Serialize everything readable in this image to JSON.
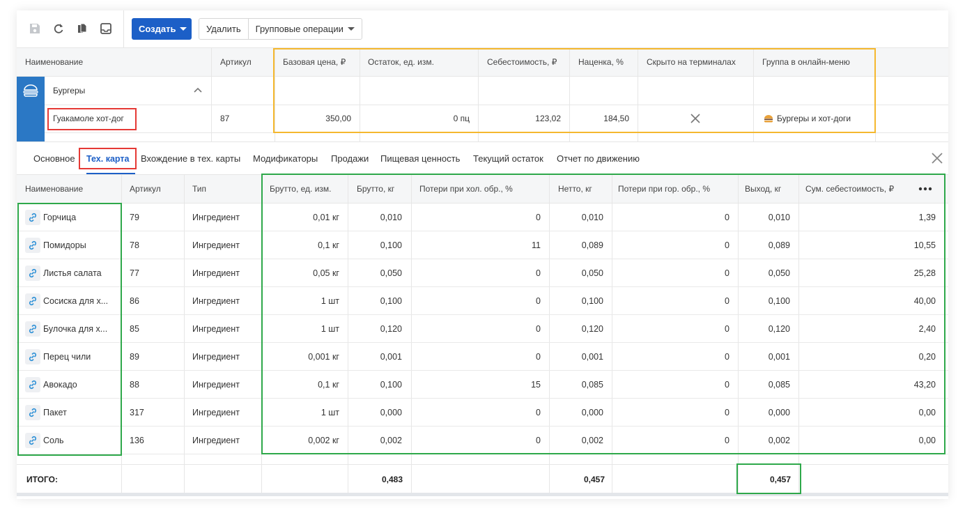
{
  "toolbar": {
    "icons": [
      "save-icon",
      "refresh-icon",
      "copy-icon",
      "inbox-icon"
    ],
    "create_label": "Создать",
    "delete_label": "Удалить",
    "group_ops_label": "Групповые операции"
  },
  "products": {
    "headers": [
      "Наименование",
      "Артикул",
      "Базовая цена, ₽",
      "Остаток, ед. изм.",
      "Себестоимость, ₽",
      "Наценка, %",
      "Скрыто на терминалах",
      "Группа в онлайн-меню"
    ],
    "group_row": {
      "name": "Бургеры"
    },
    "item": {
      "name": "Гуакамоле хот-дог",
      "article": "87",
      "base_price": "350,00",
      "stock": "0 пц",
      "cost": "123,02",
      "markup": "184,50",
      "group": "Бургеры и хот-доги"
    }
  },
  "tabs": [
    {
      "label": "Основное"
    },
    {
      "label": "Тех. карта"
    },
    {
      "label": "Вхождение в тех. карты"
    },
    {
      "label": "Модификаторы"
    },
    {
      "label": "Продажи"
    },
    {
      "label": "Пищевая ценность"
    },
    {
      "label": "Текущий остаток"
    },
    {
      "label": "Отчет по движению"
    }
  ],
  "ingredients": {
    "headers": [
      "Наименование",
      "Артикул",
      "Тип",
      "Брутто, ед. изм.",
      "Брутто, кг",
      "Потери при хол. обр., %",
      "Нетто, кг",
      "Потери при гор. обр., %",
      "Выход, кг",
      "Сум. себестоимость, ₽"
    ],
    "rows": [
      {
        "name": "Горчица",
        "article": "79",
        "type": "Ингредиент",
        "gross_unit": "0,01 кг",
        "gross_kg": "0,010",
        "cold_loss": "0",
        "net_kg": "0,010",
        "hot_loss": "0",
        "yield_kg": "0,010",
        "cost": "1,39"
      },
      {
        "name": "Помидоры",
        "article": "78",
        "type": "Ингредиент",
        "gross_unit": "0,1 кг",
        "gross_kg": "0,100",
        "cold_loss": "11",
        "net_kg": "0,089",
        "hot_loss": "0",
        "yield_kg": "0,089",
        "cost": "10,55"
      },
      {
        "name": "Листья салата",
        "article": "77",
        "type": "Ингредиент",
        "gross_unit": "0,05 кг",
        "gross_kg": "0,050",
        "cold_loss": "0",
        "net_kg": "0,050",
        "hot_loss": "0",
        "yield_kg": "0,050",
        "cost": "25,28"
      },
      {
        "name": "Сосиска для х...",
        "article": "86",
        "type": "Ингредиент",
        "gross_unit": "1 шт",
        "gross_kg": "0,100",
        "cold_loss": "0",
        "net_kg": "0,100",
        "hot_loss": "0",
        "yield_kg": "0,100",
        "cost": "40,00"
      },
      {
        "name": "Булочка для х...",
        "article": "85",
        "type": "Ингредиент",
        "gross_unit": "1 шт",
        "gross_kg": "0,120",
        "cold_loss": "0",
        "net_kg": "0,120",
        "hot_loss": "0",
        "yield_kg": "0,120",
        "cost": "2,40"
      },
      {
        "name": "Перец чили",
        "article": "89",
        "type": "Ингредиент",
        "gross_unit": "0,001 кг",
        "gross_kg": "0,001",
        "cold_loss": "0",
        "net_kg": "0,001",
        "hot_loss": "0",
        "yield_kg": "0,001",
        "cost": "0,20"
      },
      {
        "name": "Авокадо",
        "article": "88",
        "type": "Ингредиент",
        "gross_unit": "0,1 кг",
        "gross_kg": "0,100",
        "cold_loss": "15",
        "net_kg": "0,085",
        "hot_loss": "0",
        "yield_kg": "0,085",
        "cost": "43,20"
      },
      {
        "name": "Пакет",
        "article": "317",
        "type": "Ингредиент",
        "gross_unit": "1 шт",
        "gross_kg": "0,000",
        "cold_loss": "0",
        "net_kg": "0,000",
        "hot_loss": "0",
        "yield_kg": "0,000",
        "cost": "0,00"
      },
      {
        "name": "Соль",
        "article": "136",
        "type": "Ингредиент",
        "gross_unit": "0,002 кг",
        "gross_kg": "0,002",
        "cold_loss": "0",
        "net_kg": "0,002",
        "hot_loss": "0",
        "yield_kg": "0,002",
        "cost": "0,00"
      }
    ],
    "total": {
      "label": "ИТОГО:",
      "gross_kg": "0,483",
      "net_kg": "0,457",
      "yield_kg": "0,457"
    }
  },
  "colors": {
    "primary": "#1c5fc7",
    "sidebar_blue": "#2b78c5",
    "link_icon": "#2b8fd6",
    "highlight_red": "#e53935",
    "highlight_yellow": "#f5b82e",
    "highlight_green": "#2ea84a"
  }
}
